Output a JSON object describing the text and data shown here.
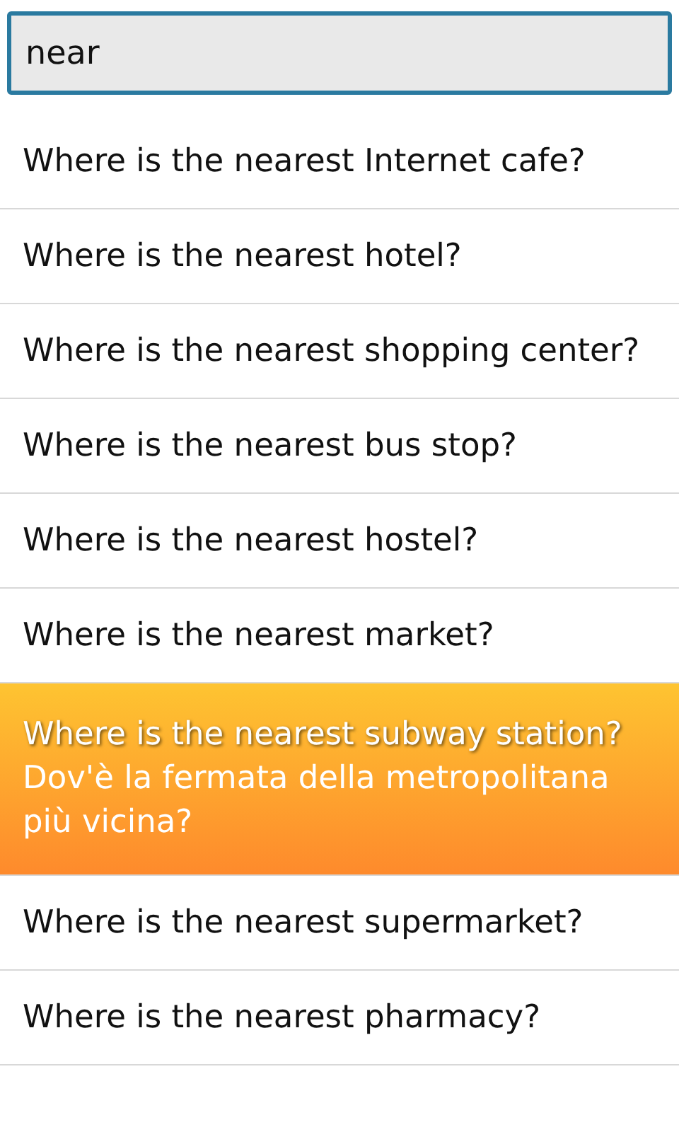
{
  "search": {
    "value": "near"
  },
  "phrases": [
    {
      "text": "Where is the nearest Internet cafe?",
      "selected": false
    },
    {
      "text": "Where is the nearest hotel?",
      "selected": false
    },
    {
      "text": "Where is the nearest shopping center?",
      "selected": false
    },
    {
      "text": "Where is the nearest bus stop?",
      "selected": false
    },
    {
      "text": "Where is the nearest hostel?",
      "selected": false
    },
    {
      "text": "Where is the nearest market?",
      "selected": false
    },
    {
      "text": "Where is the nearest subway station?",
      "translation": "Dov'è la fermata della metropolitana più vicina?",
      "selected": true
    },
    {
      "text": "Where is the nearest supermarket?",
      "selected": false
    },
    {
      "text": "Where is the nearest pharmacy?",
      "selected": false
    }
  ]
}
